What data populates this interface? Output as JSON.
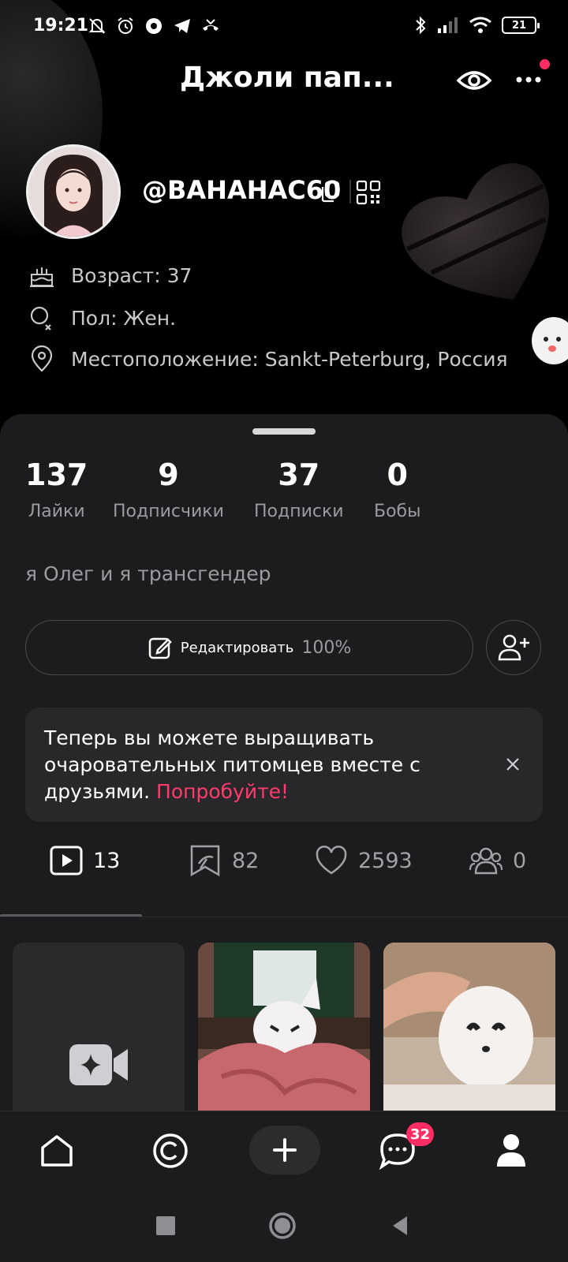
{
  "status_bar": {
    "time": "19:21",
    "battery": "21",
    "left_icons": [
      "mute-bell-icon",
      "alarm-icon",
      "chrome-icon",
      "telegram-icon",
      "missed-call-icon"
    ],
    "right_icons": [
      "bluetooth-icon",
      "signal-icon",
      "wifi-icon",
      "battery-icon"
    ]
  },
  "header": {
    "title": "Джоли пап...",
    "username": "@BAHAHAC60"
  },
  "info": {
    "age": "Возраст: 37",
    "gender": "Пол: Жен.",
    "location": "Местоположение: Sankt-Peterburg, Россия"
  },
  "stats": [
    {
      "value": "137",
      "label": "Лайки"
    },
    {
      "value": "9",
      "label": "Подписчики"
    },
    {
      "value": "37",
      "label": "Подписки"
    },
    {
      "value": "0",
      "label": "Бобы"
    }
  ],
  "bio": "я Олег и я трансгендер",
  "edit": {
    "label": "Редактировать",
    "percent": "100%"
  },
  "promo": {
    "text": "Теперь вы можете выращивать очаровательных питомцев вместе с друзьями.",
    "link": "Попробуйте!"
  },
  "tabs": [
    {
      "icon": "video-play-icon",
      "count": "13"
    },
    {
      "icon": "bookmark-icon",
      "count": "82"
    },
    {
      "icon": "heart-icon",
      "count": "2593"
    },
    {
      "icon": "group-icon",
      "count": "0"
    }
  ],
  "bottom_nav": {
    "messages_badge": "32"
  },
  "colors": {
    "accent": "#ff2d62",
    "sheet_bg": "#1c1c1e",
    "promo_link": "#ff3b6b"
  }
}
